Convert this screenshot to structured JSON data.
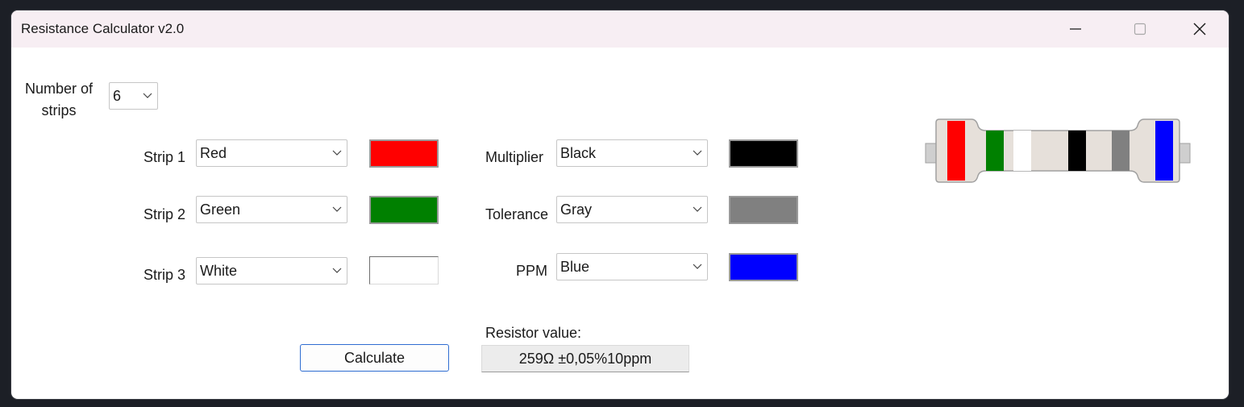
{
  "window": {
    "title": "Resistance Calculator v2.0"
  },
  "titlebar_controls": [
    "minimize-icon",
    "maximize-icon",
    "close-icon"
  ],
  "strips_count": {
    "label": "Number of strips",
    "label_line1": "Number of",
    "label_line2": "strips",
    "value": "6"
  },
  "rows": [
    {
      "label": "Strip 1",
      "value": "Red",
      "color": "#ff0000"
    },
    {
      "label": "Strip 2",
      "value": "Green",
      "color": "#008000"
    },
    {
      "label": "Strip 3",
      "value": "White",
      "color": "#ffffff"
    },
    {
      "label": "Multiplier",
      "value": "Black",
      "color": "#000000"
    },
    {
      "label": "Tolerance",
      "value": "Gray",
      "color": "#808080"
    },
    {
      "label": "PPM",
      "value": "Blue",
      "color": "#0000ff"
    }
  ],
  "calculate_label": "Calculate",
  "result": {
    "label": "Resistor value:",
    "value": "259Ω ±0,05%10ppm"
  },
  "resistor_bands": [
    "#ff0000",
    "#008000",
    "#ffffff",
    "#000000",
    "#808080",
    "#0000ff"
  ]
}
